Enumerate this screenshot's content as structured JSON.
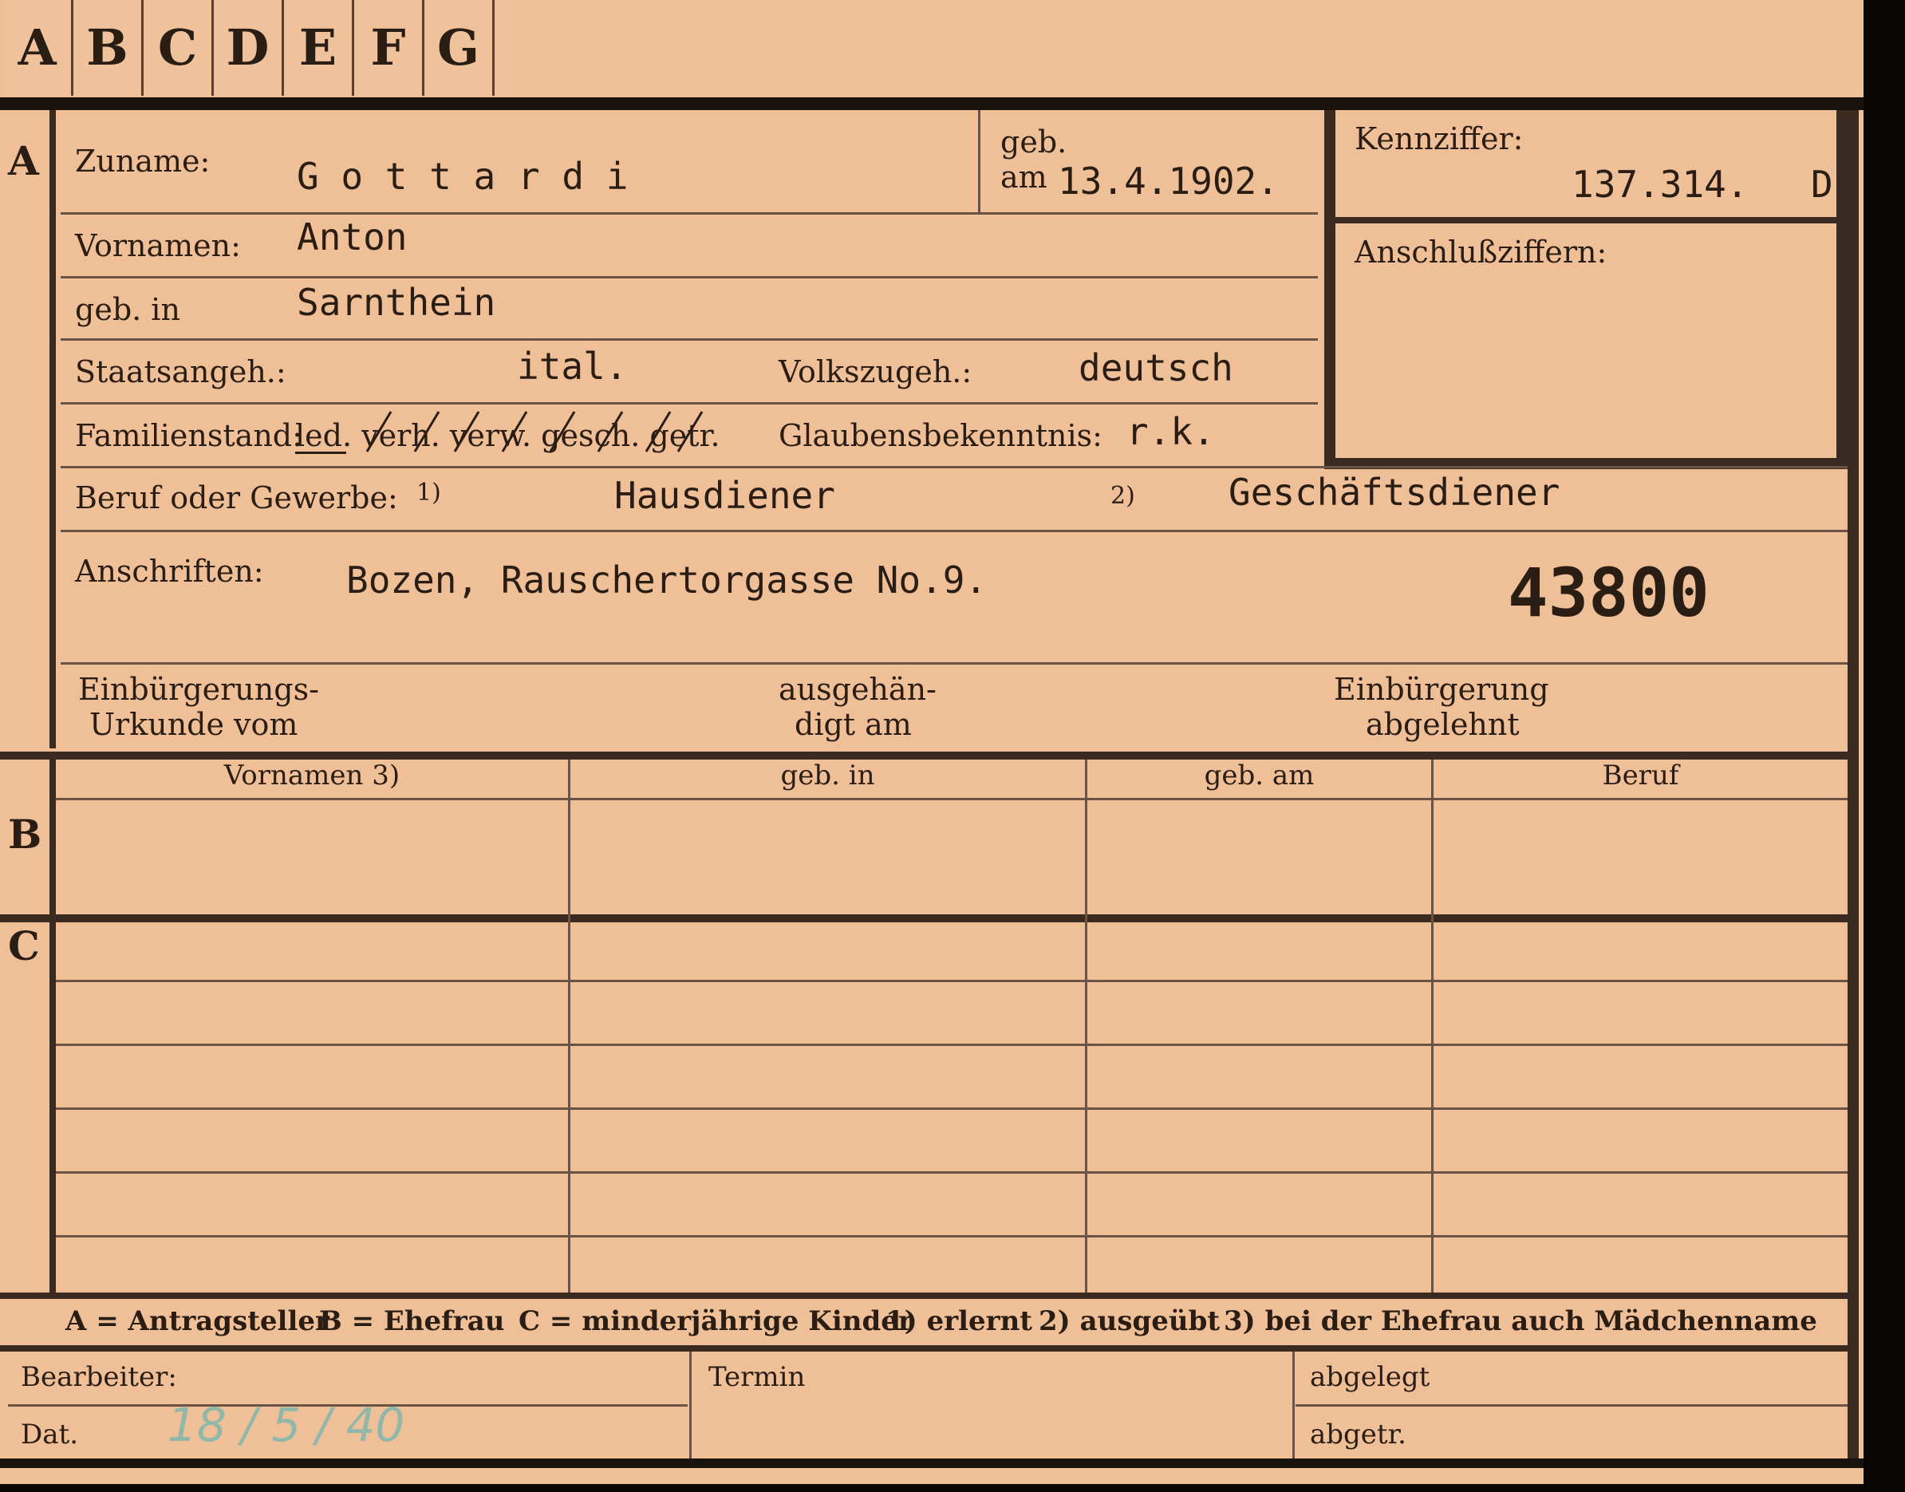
{
  "tabs": [
    "A",
    "B",
    "C",
    "D",
    "E",
    "F",
    "G"
  ],
  "section_letters": {
    "a": "A",
    "b": "B",
    "c": "C"
  },
  "header": {
    "zuname_label": "Zuname:",
    "zuname": "G o t t a r d i",
    "geb_label": "geb.",
    "am_label": "am",
    "geb_am": "13.4.1902.",
    "kennziffer_label": "Kennziffer:",
    "kennziffer": "137.314.",
    "kennziffer_suffix": "D",
    "anschluss_label": "Anschlußziffern:"
  },
  "fields": {
    "vornamen_label": "Vornamen:",
    "vornamen": "Anton",
    "gebin_label": "geb. in",
    "gebin": "Sarnthein",
    "staats_label": "Staatsangeh.:",
    "staats": "ital.",
    "volks_label": "Volkszugeh.:",
    "volks": "deutsch",
    "familien_label": "Familienstand:",
    "familien_options": "led. verh. verw. gesch. getr.",
    "glauben_label": "Glaubensbekenntnis:",
    "glauben": "r.k.",
    "beruf_label": "Beruf oder Gewerbe:",
    "beruf_note1": "1)",
    "beruf": "Hausdiener",
    "beruf_note2": "2)",
    "beruf2": "Geschäftsdiener",
    "anschriften_label": "Anschriften:",
    "anschriften": "Bozen, Rauschertorgasse No.9.",
    "stamp_number": "43800",
    "einb_label1": "Einbürgerungs-",
    "einb_label2": "Urkunde vom",
    "ausg_label1": "ausgehän-",
    "ausg_label2": "digt am",
    "abgel_label1": "Einbürgerung",
    "abgel_label2": "abgelehnt"
  },
  "table_b_headers": [
    "Vornamen 3)",
    "geb. in",
    "geb. am",
    "Beruf"
  ],
  "legend": {
    "a": "A = Antragsteller",
    "b": "B = Ehefrau",
    "c": "C = minderjährige Kinder",
    "n1": "1) erlernt",
    "n2": "2) ausgeübt",
    "n3": "3) bei der Ehefrau auch Mädchenname"
  },
  "footer": {
    "bearbeiter_label": "Bearbeiter:",
    "dat_label": "Dat.",
    "dat_value": "18 / 5 / 40",
    "termin_label": "Termin",
    "abgelegt_label": "abgelegt",
    "abgetr_label": "abgetr."
  },
  "colors": {
    "card": "#efbf98",
    "ink": "#2a1d14",
    "border": "#3b2a20",
    "pencil": "#8fb8a8"
  }
}
